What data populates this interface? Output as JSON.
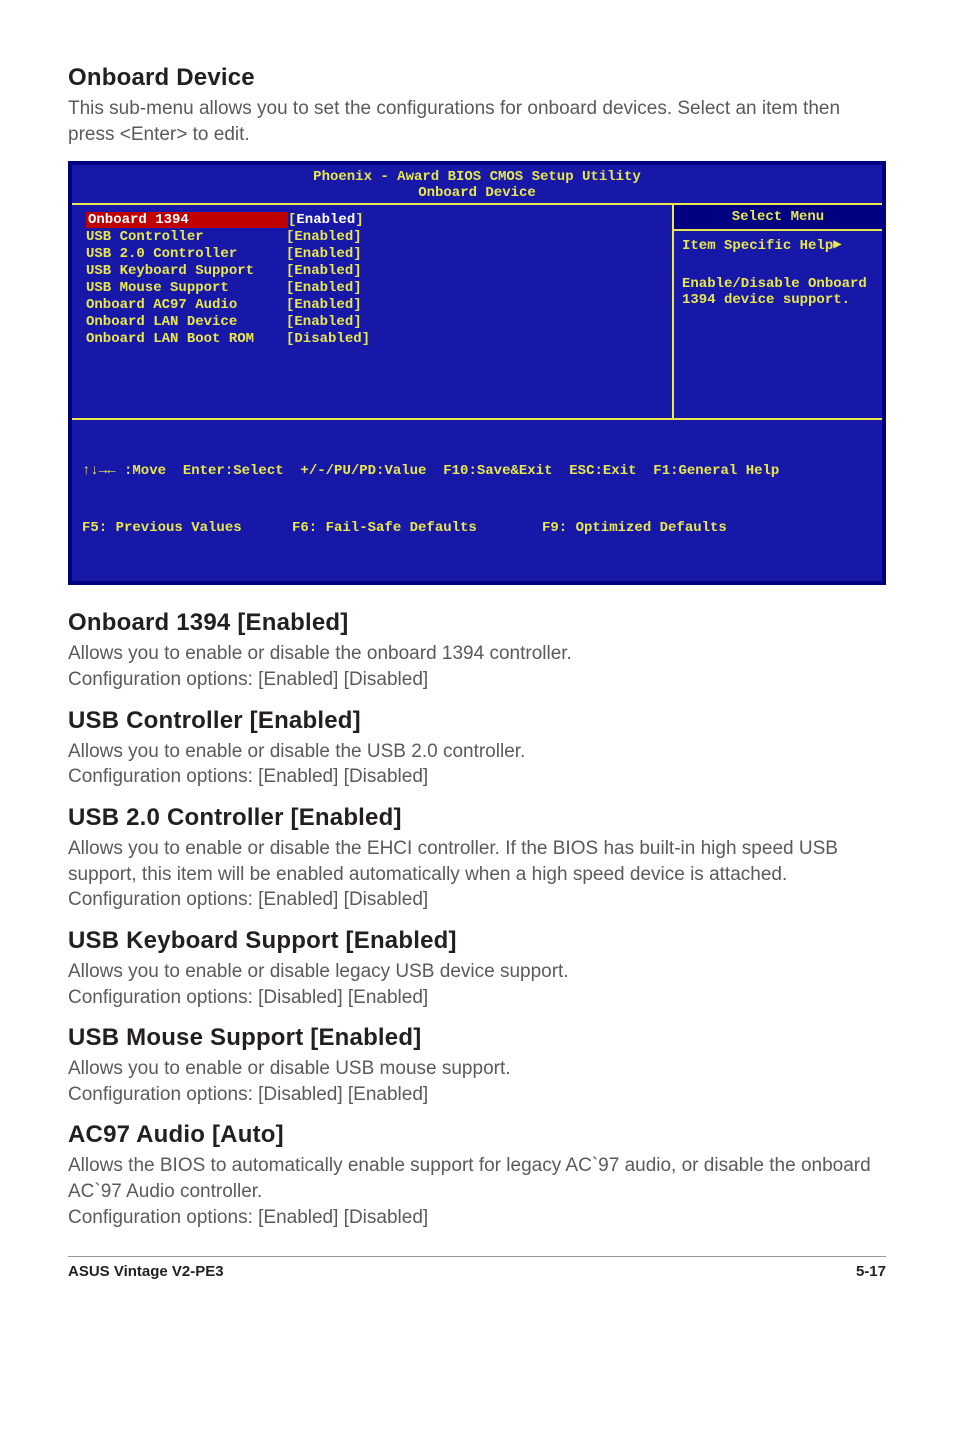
{
  "sections": {
    "onboardDevice": {
      "heading": "Onboard Device",
      "para": "This sub-menu allows you to set the configurations for onboard devices. Select an item then press <Enter> to edit."
    },
    "onboard1394": {
      "heading": "Onboard 1394 [Enabled]",
      "para1": "Allows you to enable or disable the onboard 1394 controller.",
      "para2": "Configuration options: [Enabled] [Disabled]"
    },
    "usbController": {
      "heading": "USB Controller [Enabled]",
      "para1": "Allows you to enable or disable the USB 2.0 controller.",
      "para2": "Configuration options: [Enabled] [Disabled]"
    },
    "usb20": {
      "heading": "USB 2.0 Controller [Enabled]",
      "para": "Allows you to enable or disable the EHCI controller. If the BIOS has built-in high speed USB support, this item will be enabled automatically when a high speed device is attached. Configuration options: [Enabled] [Disabled]"
    },
    "usbKeyboard": {
      "heading": "USB Keyboard Support [Enabled]",
      "para1": "Allows you to enable or disable legacy USB device support.",
      "para2": "Configuration options: [Disabled] [Enabled]"
    },
    "usbMouse": {
      "heading": "USB Mouse Support [Enabled]",
      "para1": "Allows you to enable or disable USB mouse support.",
      "para2": "Configuration options: [Disabled] [Enabled]"
    },
    "ac97": {
      "heading": "AC97 Audio [Auto]",
      "para1": "Allows the BIOS to automatically enable support for legacy AC`97 audio, or disable the onboard AC`97 Audio controller.",
      "para2": "Configuration options: [Enabled] [Disabled]"
    }
  },
  "bios": {
    "title1": "Phoenix - Award BIOS CMOS Setup Utility",
    "title2": "Onboard Device",
    "rows": [
      {
        "label": "Onboard 1394",
        "value": "Enabled",
        "selected": true
      },
      {
        "label": "USB Controller",
        "value": "Enabled",
        "selected": false
      },
      {
        "label": "USB 2.0 Controller",
        "value": "Enabled",
        "selected": false
      },
      {
        "label": "USB Keyboard Support",
        "value": "Enabled",
        "selected": false
      },
      {
        "label": "USB Mouse Support",
        "value": "Enabled",
        "selected": false
      },
      {
        "label": "Onboard AC97 Audio",
        "value": "Enabled",
        "selected": false
      },
      {
        "label": "Onboard LAN Device",
        "value": "Enabled",
        "selected": false
      },
      {
        "label": "Onboard LAN Boot ROM",
        "value": "Disabled",
        "selected": false
      }
    ],
    "selectMenu": "Select Menu",
    "helpTitle": "Item Specific Help",
    "help1": "Enable/Disable Onboard",
    "help2": "1394 device support.",
    "footer1": "↑↓→← :Move  Enter:Select  +/-/PU/PD:Value  F10:Save&Exit  ESC:Exit  F1:General Help",
    "footer2a": "F5: Previous Values",
    "footer2b": "F6: Fail-Safe Defaults",
    "footer2c": "F9: Optimized Defaults"
  },
  "footer": {
    "left": "ASUS Vintage V2-PE3",
    "right": "5-17"
  }
}
